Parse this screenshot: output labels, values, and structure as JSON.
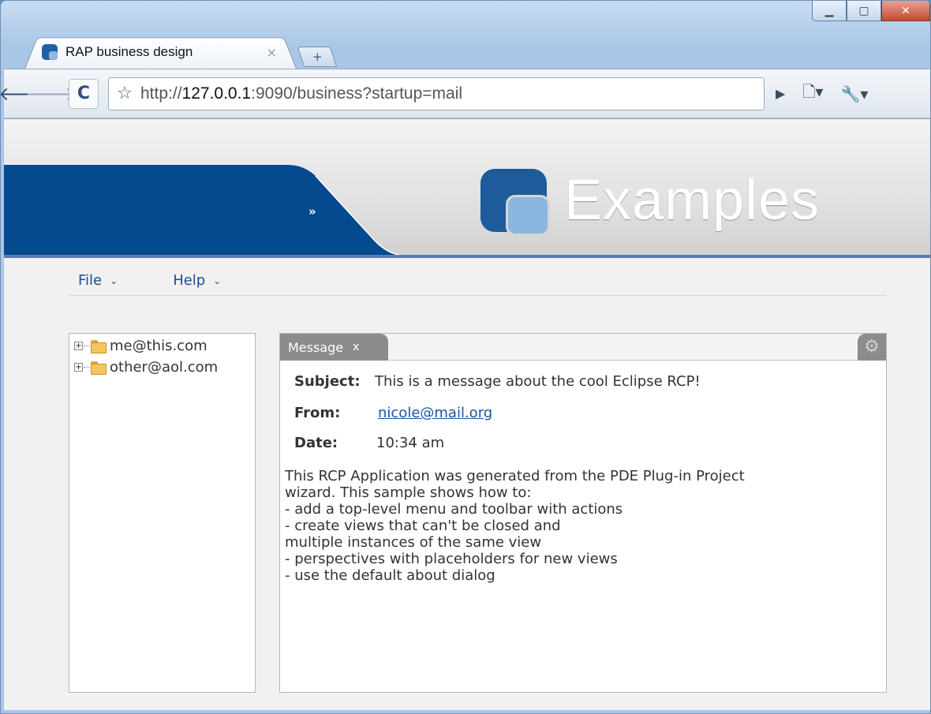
{
  "browser": {
    "tab_title": "RAP business design",
    "tab_close": "×",
    "new_tab": "+",
    "url_prefix": "http://",
    "url_host": "127.0.0.1",
    "url_rest": ":9090/business?startup=mail"
  },
  "banner": {
    "title": "Examples",
    "chevron": "»",
    "colors": {
      "blue": "#05498f",
      "logo_dark": "#1d5b9b",
      "logo_light": "#8ab6df"
    }
  },
  "menubar": {
    "items": [
      {
        "label": "File"
      },
      {
        "label": "Help"
      }
    ]
  },
  "tree": {
    "nodes": [
      {
        "label": "me@this.com"
      },
      {
        "label": "other@aol.com"
      }
    ]
  },
  "message": {
    "tab_label": "Message",
    "tab_close": "x",
    "subject_label": "Subject:",
    "subject": "This is a message about the cool Eclipse RCP!",
    "from_label": "From:",
    "from": "nicole@mail.org",
    "date_label": "Date:",
    "date": "10:34 am",
    "body": "This RCP Application was generated from the PDE Plug-in Project\nwizard. This sample shows how to:\n- add a top-level menu and toolbar with actions\n- create views that can't be closed and\n  multiple instances of the same view\n- perspectives with placeholders for new views\n- use the default about dialog"
  }
}
